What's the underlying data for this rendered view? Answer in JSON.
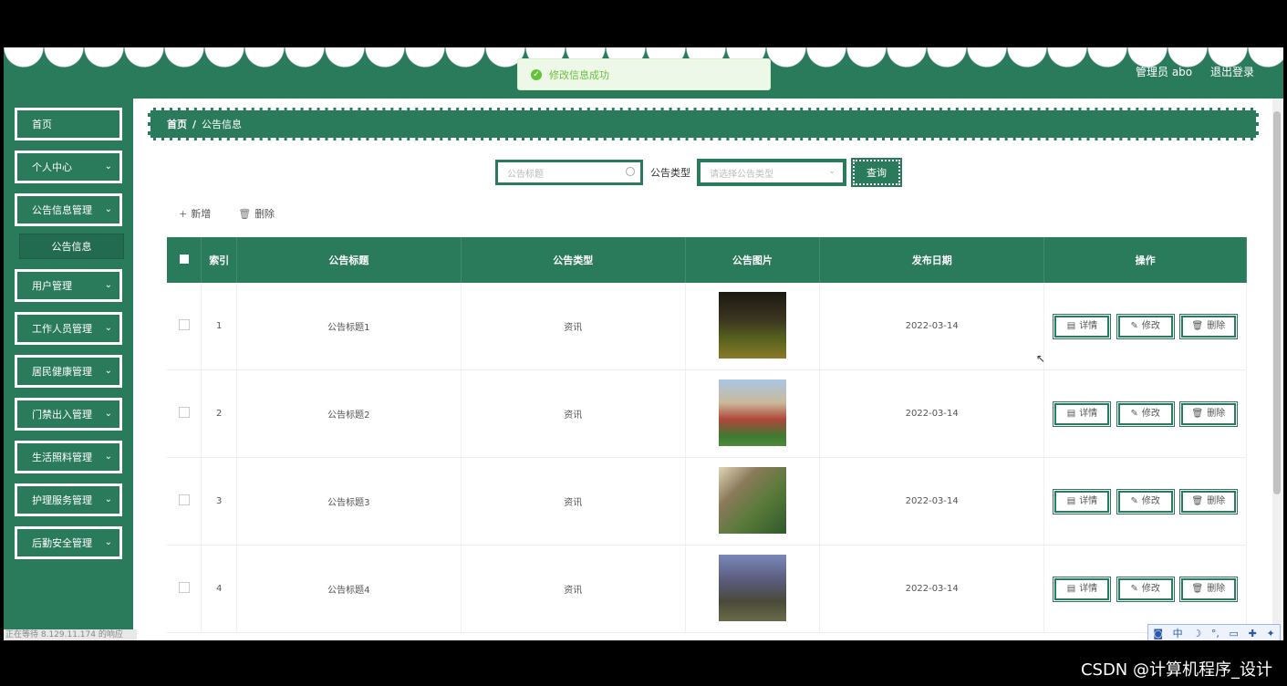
{
  "header": {
    "user_label": "管理员 abo",
    "logout_label": "退出登录"
  },
  "toast": {
    "message": "修改信息成功"
  },
  "sidebar": {
    "items": [
      {
        "label": "首页",
        "has_sub": false
      },
      {
        "label": "个人中心",
        "has_sub": true
      },
      {
        "label": "公告信息管理",
        "has_sub": true
      },
      {
        "label": "用户管理",
        "has_sub": true
      },
      {
        "label": "工作人员管理",
        "has_sub": true
      },
      {
        "label": "居民健康管理",
        "has_sub": true
      },
      {
        "label": "门禁出入管理",
        "has_sub": true
      },
      {
        "label": "生活照料管理",
        "has_sub": true
      },
      {
        "label": "护理服务管理",
        "has_sub": true
      },
      {
        "label": "后勤安全管理",
        "has_sub": true
      }
    ],
    "submenu_active": "公告信息",
    "status_text": "正在等待 8.129.11.174 的响应"
  },
  "breadcrumb": {
    "home": "首页",
    "separator": "/",
    "current": "公告信息"
  },
  "search": {
    "title_placeholder": "公告标题",
    "type_label": "公告类型",
    "type_placeholder": "请选择公告类型",
    "query_label": "查询"
  },
  "toolbar": {
    "add_label": "新增",
    "delete_label": "删除"
  },
  "table": {
    "headers": [
      "索引",
      "公告标题",
      "公告类型",
      "公告图片",
      "发布日期",
      "操作"
    ],
    "rows": [
      {
        "index": "1",
        "title": "公告标题1",
        "type": "资讯",
        "date": "2022-03-14"
      },
      {
        "index": "2",
        "title": "公告标题2",
        "type": "资讯",
        "date": "2022-03-14"
      },
      {
        "index": "3",
        "title": "公告标题3",
        "type": "资讯",
        "date": "2022-03-14"
      },
      {
        "index": "4",
        "title": "公告标题4",
        "type": "资讯",
        "date": "2022-03-14"
      }
    ],
    "op_labels": {
      "detail": "详情",
      "edit": "修改",
      "delete": "删除"
    }
  },
  "ime": {
    "label": "中"
  },
  "watermark": "CSDN @计算机程序_设计",
  "colors": {
    "primary": "#2a7a5c",
    "success": "#67c23a"
  }
}
